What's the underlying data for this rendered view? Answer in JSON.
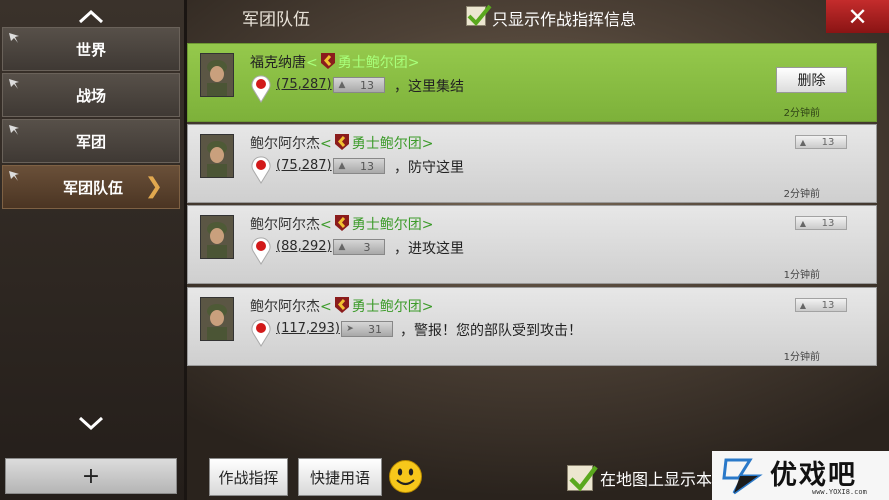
{
  "sidebar": {
    "tabs": [
      {
        "label": "世界"
      },
      {
        "label": "战场"
      },
      {
        "label": "军团"
      },
      {
        "label": "军团队伍",
        "active": true
      }
    ],
    "add_label": "+"
  },
  "header": {
    "title": "军团队伍",
    "filter_label": "只显示作战指挥信息",
    "filter_checked": true,
    "close_label": "✕"
  },
  "messages": [
    {
      "sender": "福克纳唐",
      "guild": "勇士鲍尔团",
      "coords": "(75,287)",
      "troop_count": "13",
      "text": "，这里集结",
      "time": "2分钟前",
      "highlighted": true,
      "action_label": "删除"
    },
    {
      "sender": "鲍尔阿尔杰",
      "guild": "勇士鲍尔团",
      "coords": "(75,287)",
      "troop_count": "13",
      "text": "，防守这里",
      "time": "2分钟前",
      "side_count": "13"
    },
    {
      "sender": "鲍尔阿尔杰",
      "guild": "勇士鲍尔团",
      "coords": "(88,292)",
      "troop_count": "3",
      "text": "，进攻这里",
      "time": "1分钟前",
      "side_count": "13"
    },
    {
      "sender": "鲍尔阿尔杰",
      "guild": "勇士鲍尔团",
      "coords": "(117,293)",
      "troop_count": "31",
      "text": "，警报！您的部队受到攻击！",
      "time": "1分钟前",
      "side_count": "13"
    }
  ],
  "footer": {
    "battle_command_label": "作战指挥",
    "quick_phrases_label": "快捷用语",
    "map_display_label": "在地图上显示本",
    "map_display_checked": true
  },
  "watermark": {
    "text": "优戏吧",
    "url": "www.YOXI8.com"
  },
  "colors": {
    "highlight": "#8cc043",
    "guild_green": "#3d9b2b",
    "close_red": "#b32020"
  },
  "lt": "<",
  "gt": ">"
}
